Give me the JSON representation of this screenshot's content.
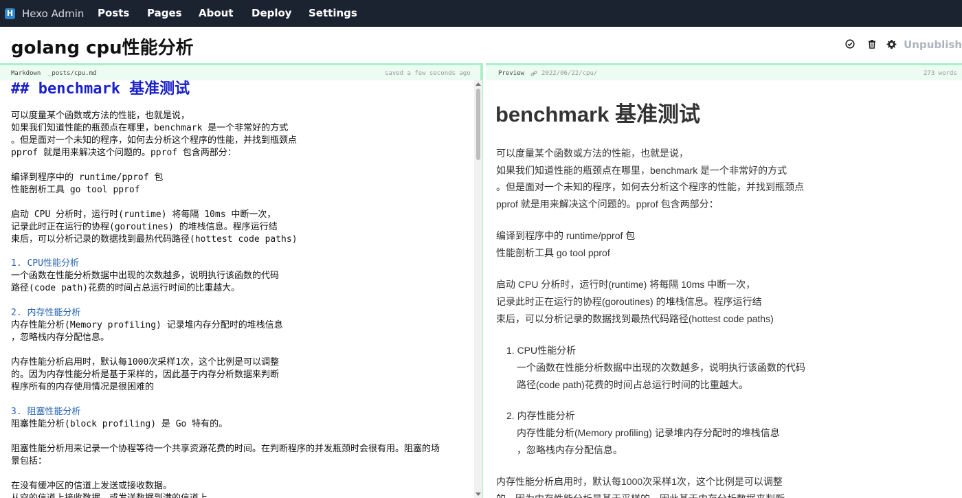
{
  "app": {
    "brand": "Hexo Admin",
    "nav": [
      "Posts",
      "Pages",
      "About",
      "Deploy",
      "Settings"
    ]
  },
  "post": {
    "title": "golang cpu性能分析",
    "unpublish_label": "Unpublish",
    "toolbar_icons": [
      "check-circle-icon",
      "trash-icon",
      "gear-icon"
    ]
  },
  "editor": {
    "mode_label": "Markdown",
    "path": "_posts/cpu.md",
    "save_status": "saved a few seconds ago",
    "lines": [
      "## benchmark 基准测试",
      "可以度量某个函数或方法的性能，也就是说，",
      "如果我们知道性能的瓶颈点在哪里，benchmark 是一个非常好的方式",
      "。但是面对一个未知的程序，如何去分析这个程序的性能，并找到瓶颈点",
      "pprof 就是用来解决这个问题的。pprof 包含两部分：",
      "编译到程序中的 runtime/pprof 包",
      "性能剖析工具 go tool pprof",
      "启动 CPU 分析时，运行时(runtime) 将每隔 10ms 中断一次，",
      "记录此时正在运行的协程(goroutines) 的堆栈信息。程序运行结",
      "束后，可以分析记录的数据找到最热代码路径(hottest code paths)",
      "1. CPU性能分析",
      "一个函数在性能分析数据中出现的次数越多，说明执行该函数的代码",
      "路径(code path)花费的时间占总运行时间的比重越大。",
      "2. 内存性能分析",
      "内存性能分析(Memory profiling) 记录堆内存分配时的堆栈信息",
      "，忽略栈内存分配信息。",
      "内存性能分析启用时，默认每1000次采样1次，这个比例是可以调整",
      "的。因为内存性能分析是基于采样的，因此基于内存分析数据来判断",
      "程序所有的内存使用情况是很困难的",
      "3. 阻塞性能分析",
      "阻塞性能分析(block profiling) 是 Go 特有的。",
      "阻塞性能分析用来记录一个协程等待一个共享资源花费的时间。在判断程序的并发瓶颈时会很有用。阻塞的场",
      "景包括：",
      "在没有缓冲区的信道上发送或接收数据。",
      "从空的信道上接收数据，或发送数据到满的信道上。"
    ]
  },
  "preview": {
    "label": "Preview",
    "permalink": "2022/06/22/cpu/",
    "word_count": "273 words",
    "heading": "benchmark 基准测试",
    "lines": [
      "可以度量某个函数或方法的性能，也就是说，",
      "如果我们知道性能的瓶颈点在哪里，benchmark 是一个非常好的方式",
      "。但是面对一个未知的程序，如何去分析这个程序的性能，并找到瓶颈点",
      "pprof 就是用来解决这个问题的。pprof 包含两部分：",
      "编译到程序中的 runtime/pprof 包",
      "性能剖析工具 go tool pprof",
      "启动 CPU 分析时，运行时(runtime) 将每隔 10ms 中断一次，",
      "记录此时正在运行的协程(goroutines) 的堆栈信息。程序运行结",
      "束后，可以分析记录的数据找到最热代码路径(hottest code paths)",
      "1. CPU性能分析",
      "一个函数在性能分析数据中出现的次数越多，说明执行该函数的代码",
      "路径(code path)花费的时间占总运行时间的比重越大。",
      "2. 内存性能分析",
      "内存性能分析(Memory profiling) 记录堆内存分配时的堆栈信息",
      "，忽略栈内存分配信息。",
      "内存性能分析启用时，默认每1000次采样1次，这个比例是可以调整",
      "的。因为内存性能分析是基于采样的，因此基于内存分析数据来判断"
    ]
  }
}
